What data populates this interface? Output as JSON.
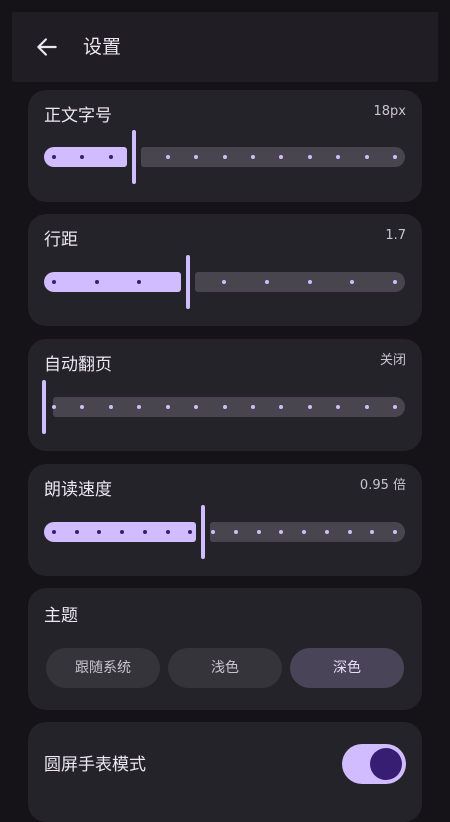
{
  "header": {
    "title": "设置",
    "back_icon": "arrow-left-icon"
  },
  "font_size": {
    "label": "正文字号",
    "value": "18px",
    "level": 0.25,
    "steps": 13
  },
  "line_spacing": {
    "label": "行距",
    "value": "1.7",
    "level": 0.4,
    "steps": 9
  },
  "auto_page": {
    "label": "自动翻页",
    "value": "关闭",
    "level": 0.0,
    "steps": 13
  },
  "tts_speed": {
    "label": "朗读速度",
    "value": "0.95 倍",
    "level": 0.44,
    "steps": 16
  },
  "theme": {
    "label": "主题",
    "options": [
      "跟随系统",
      "浅色",
      "深色"
    ],
    "selected": "深色"
  },
  "round_watch": {
    "label": "圆屏手表模式",
    "enabled": true
  },
  "colors": {
    "accent": "#D0BCFF",
    "surface": "#25232A",
    "background": "#151318",
    "inactive_track": "#49454F"
  }
}
